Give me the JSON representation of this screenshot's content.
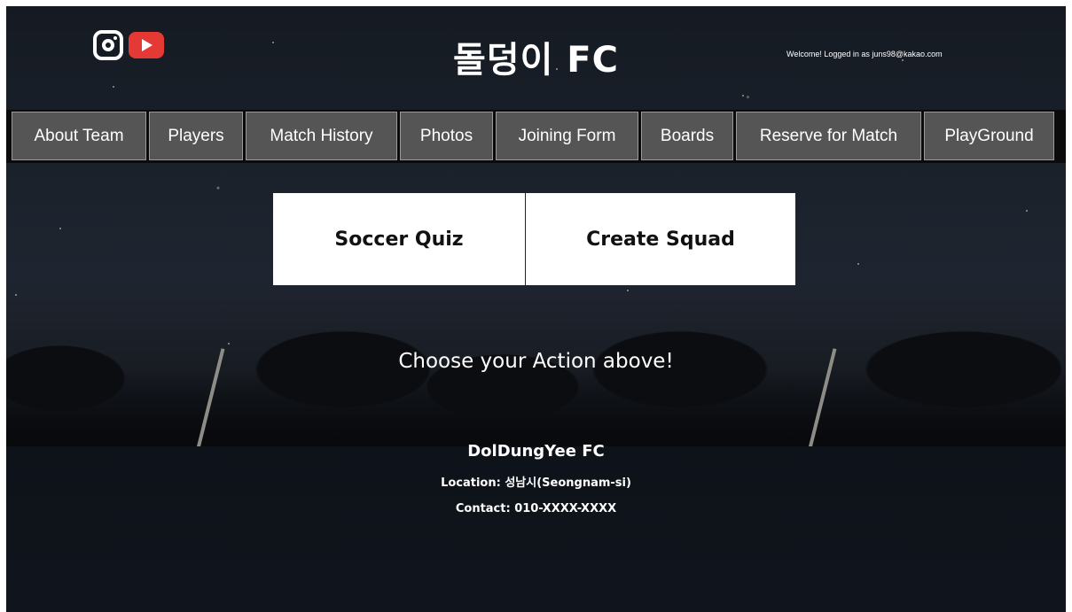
{
  "header": {
    "title": "돌덩이 FC",
    "welcome": "Welcome! Logged in as juns98@kakao.com",
    "social_icons": [
      "instagram-icon",
      "youtube-icon"
    ]
  },
  "nav": {
    "items": [
      {
        "label": "About Team"
      },
      {
        "label": "Players"
      },
      {
        "label": "Match History"
      },
      {
        "label": "Photos"
      },
      {
        "label": "Joining Form"
      },
      {
        "label": "Boards"
      },
      {
        "label": "Reserve for Match"
      },
      {
        "label": "PlayGround"
      }
    ]
  },
  "actions": {
    "quiz_label": "Soccer Quiz",
    "squad_label": "Create Squad"
  },
  "main": {
    "prompt": "Choose your Action above!"
  },
  "footer": {
    "team_name": "DolDungYee FC",
    "location": "Location: 성남시(Seongnam-si)",
    "contact": "Contact: 010-XXXX-XXXX"
  },
  "colors": {
    "nav_bg": "#555555",
    "youtube_red": "#e53935",
    "page_dark": "#151a22"
  }
}
